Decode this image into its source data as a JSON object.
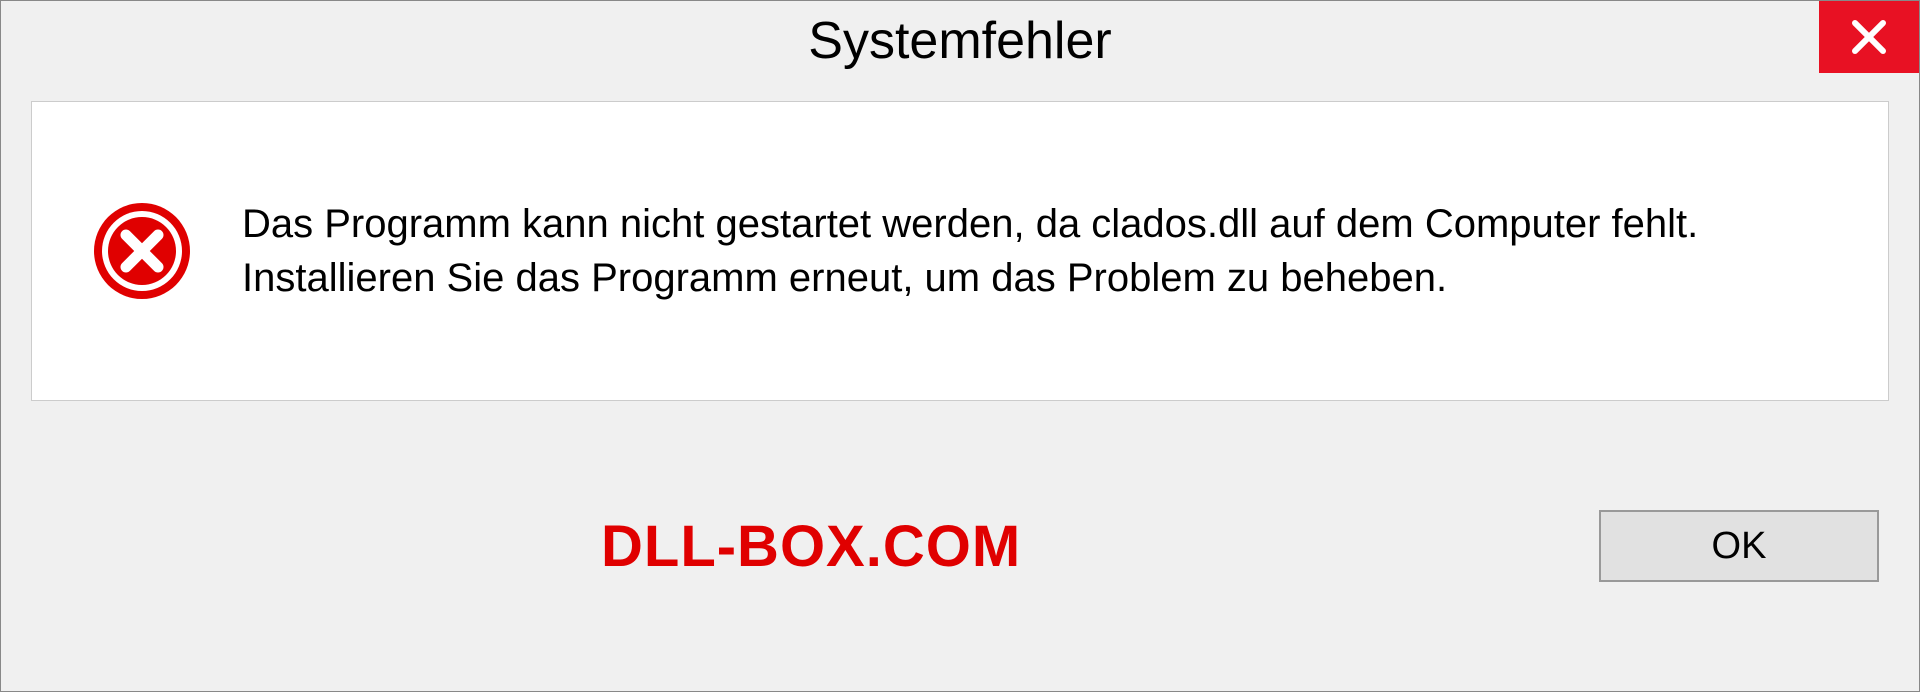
{
  "dialog": {
    "title": "Systemfehler",
    "message": "Das Programm kann nicht gestartet werden, da clados.dll auf dem Computer fehlt. Installieren Sie das Programm erneut, um das Problem zu beheben.",
    "ok_label": "OK"
  },
  "watermark": "DLL-BOX.COM"
}
